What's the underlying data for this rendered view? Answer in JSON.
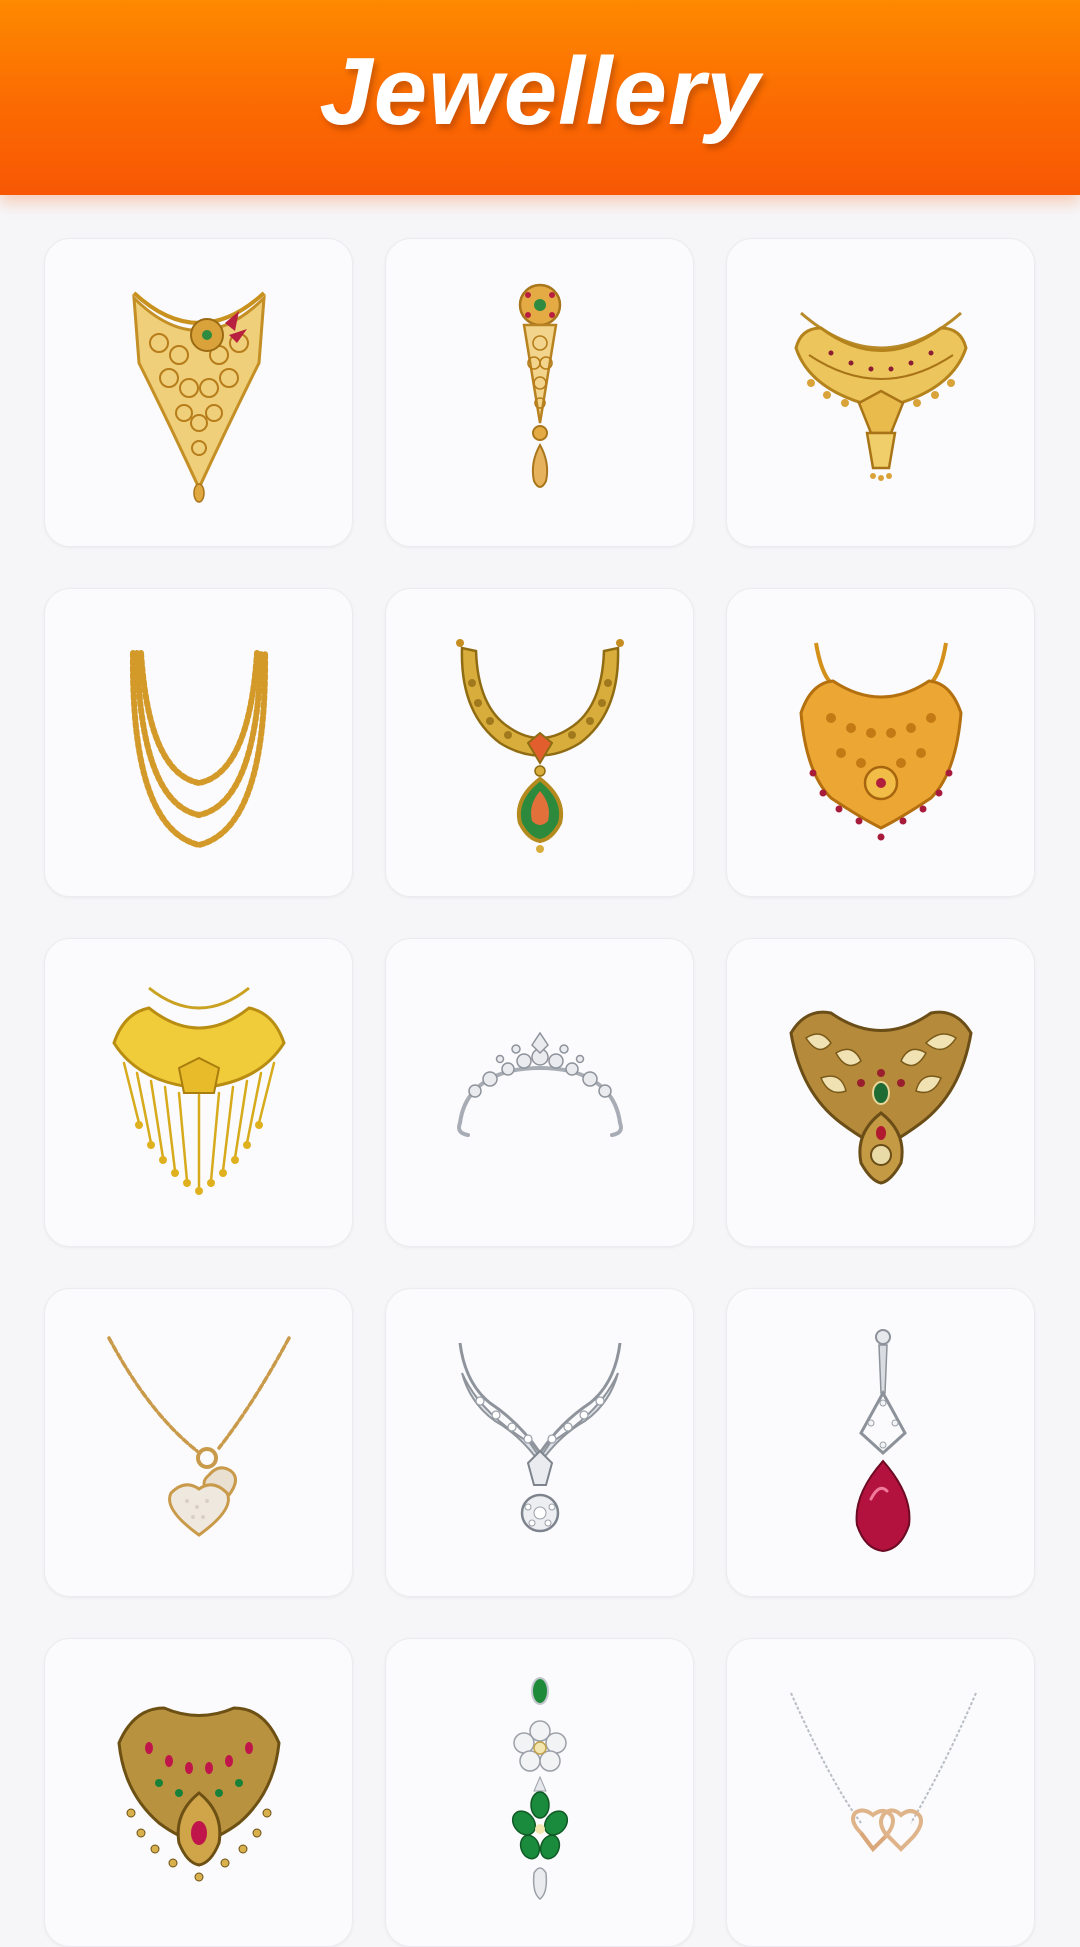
{
  "header": {
    "title": "Jewellery"
  },
  "colors": {
    "header_top": "#fd8a00",
    "header_bottom": "#f85704",
    "background": "#f6f6f8",
    "card": "#fbfbfd",
    "gold": "#e2a52a",
    "silver": "#c9ccd2",
    "ruby": "#b81e47",
    "emerald": "#1f8a3a",
    "rose_gold": "#e0b48a"
  },
  "items": [
    {
      "icon": "gold-mesh-necklace-icon"
    },
    {
      "icon": "gold-floral-drop-pendant-icon"
    },
    {
      "icon": "gold-wide-collar-necklace-icon"
    },
    {
      "icon": "gold-triple-chain-necklace-icon"
    },
    {
      "icon": "gold-ruby-emerald-pendant-necklace-icon"
    },
    {
      "icon": "gold-bridal-choker-icon"
    },
    {
      "icon": "gold-bead-fringe-necklace-icon"
    },
    {
      "icon": "silver-diamond-tiara-icon"
    },
    {
      "icon": "antique-kundan-necklace-icon"
    },
    {
      "icon": "gold-chain-heart-pendant-icon"
    },
    {
      "icon": "silver-diamond-v-necklace-icon"
    },
    {
      "icon": "ruby-teardrop-earring-icon"
    },
    {
      "icon": "ruby-emerald-bib-necklace-icon"
    },
    {
      "icon": "emerald-diamond-drop-earring-icon"
    },
    {
      "icon": "double-heart-silver-chain-necklace-icon"
    }
  ]
}
